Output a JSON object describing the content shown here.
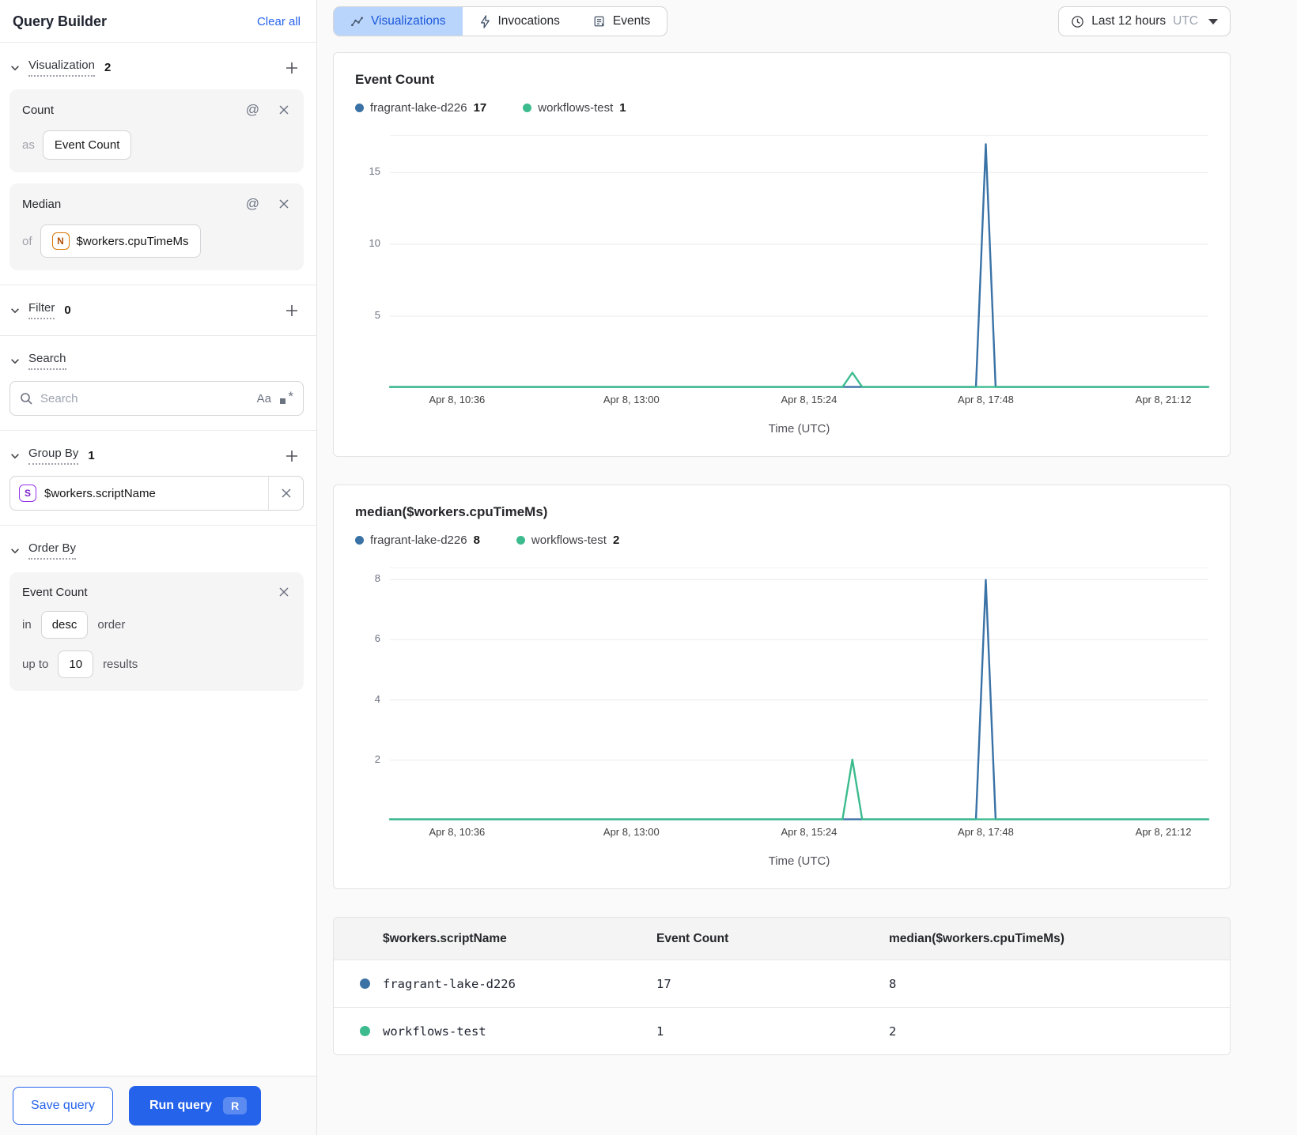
{
  "sidebar": {
    "title": "Query Builder",
    "clear_all": "Clear all",
    "at_symbol": "@",
    "visualization": {
      "label": "Visualization",
      "count": "2",
      "cards": [
        {
          "title": "Count",
          "prefix": "as",
          "value": "Event Count"
        },
        {
          "title": "Median",
          "prefix": "of",
          "badge": "N",
          "value": "$workers.cpuTimeMs"
        }
      ]
    },
    "filter": {
      "label": "Filter",
      "count": "0"
    },
    "search": {
      "label": "Search",
      "placeholder": "Search",
      "case_icon": "Aa",
      "regex_star": "*"
    },
    "group_by": {
      "label": "Group By",
      "count": "1",
      "item": {
        "badge": "S",
        "value": "$workers.scriptName"
      }
    },
    "order_by": {
      "label": "Order By",
      "field": "Event Count",
      "in_label": "in",
      "direction": "desc",
      "order_label": "order",
      "up_to_label": "up to",
      "limit": "10",
      "results_label": "results"
    },
    "save_button": "Save query",
    "run_button": "Run query",
    "run_shortcut": "R"
  },
  "topbar": {
    "tabs": [
      {
        "label": "Visualizations",
        "active": true
      },
      {
        "label": "Invocations",
        "active": false
      },
      {
        "label": "Events",
        "active": false
      }
    ],
    "time_range": {
      "label": "Last 12 hours",
      "zone": "UTC"
    }
  },
  "colors": {
    "blue": "#3a72a6",
    "green": "#3cbc8e",
    "accent": "#2563eb",
    "tab_active_bg": "#b9d5fb"
  },
  "chart_data": [
    {
      "type": "line",
      "title": "Event Count",
      "legend": [
        {
          "name": "fragrant-lake-d226",
          "value": "17",
          "color": "#3a72a6"
        },
        {
          "name": "workflows-test",
          "value": "1",
          "color": "#3cbc8e"
        }
      ],
      "ylim": [
        0,
        17.6
      ],
      "yticks": [
        5,
        10,
        15
      ],
      "xlabel": "Time (UTC)",
      "grid": true,
      "legend_position": "top-left",
      "xticks": [
        {
          "label": "Apr 8, 10:36",
          "pos": 0.082
        },
        {
          "label": "Apr 8, 13:00",
          "pos": 0.295
        },
        {
          "label": "Apr 8, 15:24",
          "pos": 0.512
        },
        {
          "label": "Apr 8, 17:48",
          "pos": 0.728
        },
        {
          "label": "Apr 8, 21:12",
          "pos": 0.945
        }
      ],
      "spikes": [
        {
          "series": "fragrant-lake-d226",
          "time": "Apr 8, 17:48",
          "value": 17
        },
        {
          "series": "workflows-test",
          "time": "Apr 8, 15:45",
          "value": 1
        }
      ],
      "series": [
        {
          "name": "fragrant-lake-d226",
          "color": "#3a72a6",
          "points": [
            [
              0,
              0
            ],
            [
              0.716,
              0
            ],
            [
              0.728,
              17
            ],
            [
              0.74,
              0
            ],
            [
              1,
              0
            ]
          ]
        },
        {
          "name": "workflows-test",
          "color": "#3cbc8e",
          "points": [
            [
              0,
              0
            ],
            [
              0.553,
              0
            ],
            [
              0.565,
              1
            ],
            [
              0.577,
              0
            ],
            [
              1,
              0
            ]
          ]
        }
      ]
    },
    {
      "type": "line",
      "title": "median($workers.cpuTimeMs)",
      "legend": [
        {
          "name": "fragrant-lake-d226",
          "value": "8",
          "color": "#3a72a6"
        },
        {
          "name": "workflows-test",
          "value": "2",
          "color": "#3cbc8e"
        }
      ],
      "ylim": [
        0,
        8.4
      ],
      "yticks": [
        2,
        4,
        6,
        8
      ],
      "xlabel": "Time (UTC)",
      "grid": true,
      "legend_position": "top-left",
      "xticks": [
        {
          "label": "Apr 8, 10:36",
          "pos": 0.082
        },
        {
          "label": "Apr 8, 13:00",
          "pos": 0.295
        },
        {
          "label": "Apr 8, 15:24",
          "pos": 0.512
        },
        {
          "label": "Apr 8, 17:48",
          "pos": 0.728
        },
        {
          "label": "Apr 8, 21:12",
          "pos": 0.945
        }
      ],
      "spikes": [
        {
          "series": "fragrant-lake-d226",
          "time": "Apr 8, 17:48",
          "value": 8
        },
        {
          "series": "workflows-test",
          "time": "Apr 8, 15:45",
          "value": 2
        }
      ],
      "series": [
        {
          "name": "fragrant-lake-d226",
          "color": "#3a72a6",
          "points": [
            [
              0,
              0
            ],
            [
              0.716,
              0
            ],
            [
              0.728,
              8
            ],
            [
              0.74,
              0
            ],
            [
              1,
              0
            ]
          ]
        },
        {
          "name": "workflows-test",
          "color": "#3cbc8e",
          "points": [
            [
              0,
              0
            ],
            [
              0.553,
              0
            ],
            [
              0.565,
              2
            ],
            [
              0.577,
              0
            ],
            [
              1,
              0
            ]
          ]
        }
      ]
    },
    {
      "type": "table",
      "columns": [
        "$workers.scriptName",
        "Event Count",
        "median($workers.cpuTimeMs)"
      ],
      "rows": [
        {
          "dot": "#3a72a6",
          "cells": [
            "fragrant-lake-d226",
            "17",
            "8"
          ]
        },
        {
          "dot": "#3cbc8e",
          "cells": [
            "workflows-test",
            "1",
            "2"
          ]
        }
      ]
    }
  ]
}
